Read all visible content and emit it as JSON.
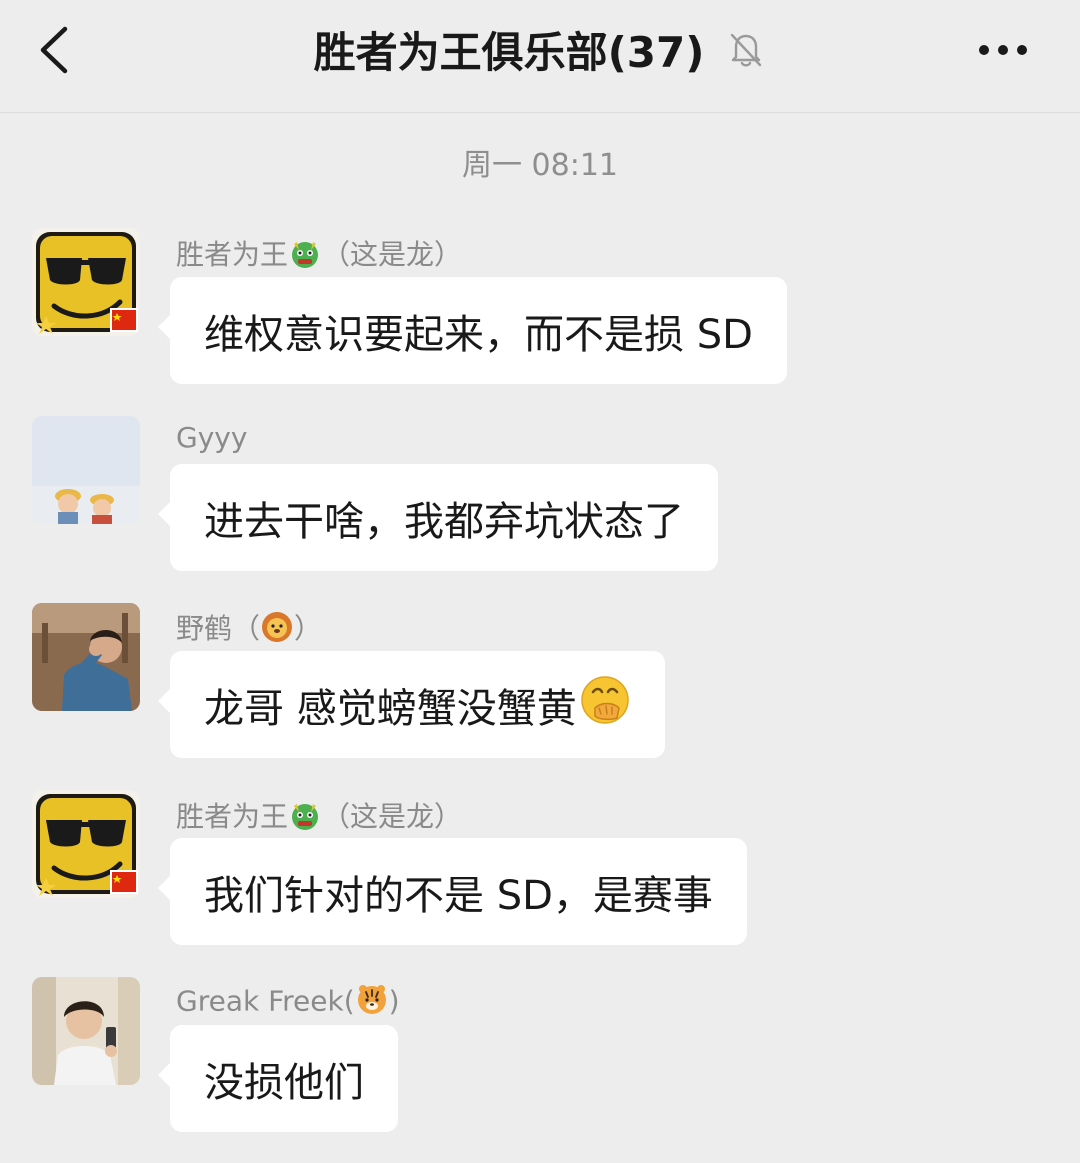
{
  "header": {
    "title": "胜者为王俱乐部(37)",
    "back_icon": "chevron-left-icon",
    "mute_icon": "bell-off-icon",
    "more_icon": "more-dots-icon"
  },
  "timestamp": "周一 08:11",
  "messages": [
    {
      "sender": "胜者为王",
      "sender_suffix": "（这是龙）",
      "sender_emoji": "dragon-emoji",
      "avatar": "sunglasses-emoji-avatar",
      "text": "维权意识要起来，而不是损 SD"
    },
    {
      "sender": "Gyyy",
      "avatar": "two-kids-photo-avatar",
      "text": "进去干啥，我都弃坑状态了"
    },
    {
      "sender": "野鹤（",
      "sender_suffix": "）",
      "sender_emoji": "lion-emoji",
      "avatar": "man-blue-shirt-photo-avatar",
      "text": "龙哥 感觉螃蟹没蟹黄",
      "text_emoji": "face-hand-over-mouth-emoji"
    },
    {
      "sender": "胜者为王",
      "sender_suffix": "（这是龙）",
      "sender_emoji": "dragon-emoji",
      "avatar": "sunglasses-emoji-avatar",
      "text": "我们针对的不是 SD，是赛事"
    },
    {
      "sender": "Greak Freek(",
      "sender_suffix": ")",
      "sender_emoji": "tiger-emoji",
      "avatar": "young-man-selfie-photo-avatar",
      "text": "没损他们"
    }
  ],
  "colors": {
    "background": "#ededed",
    "bubble": "#ffffff",
    "sender_text": "#8a8a8a",
    "message_text": "#191919",
    "flag_red": "#de2910",
    "flag_yellow": "#ffde00"
  }
}
